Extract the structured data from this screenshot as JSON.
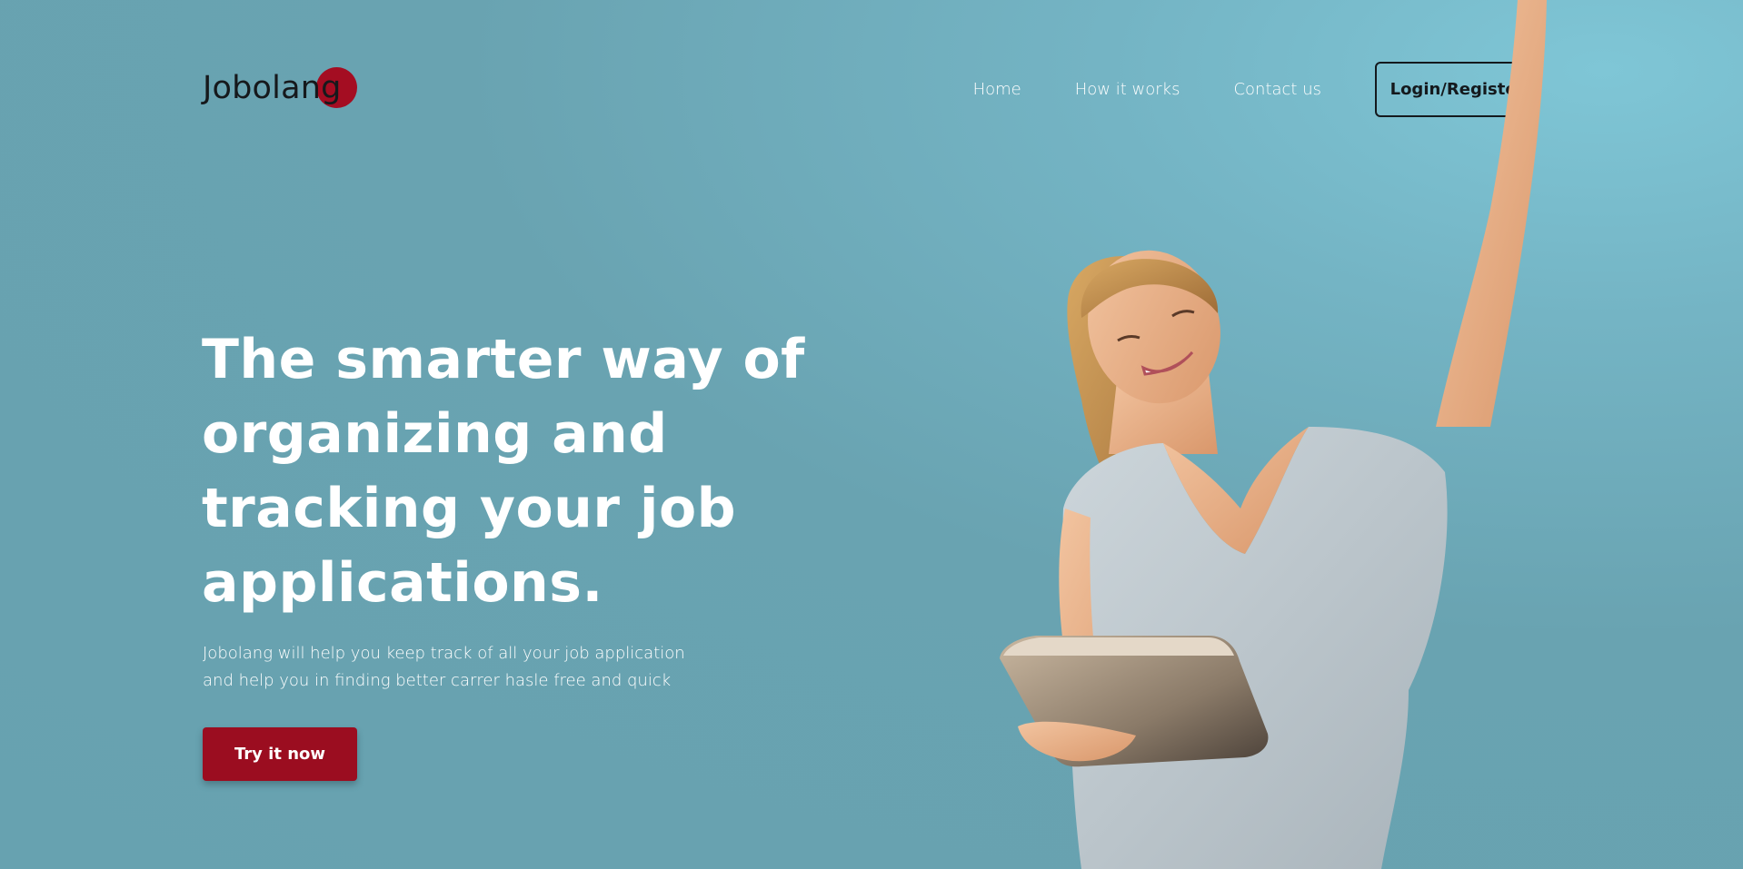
{
  "brand": {
    "name": "Jobolang",
    "accent_color": "#a40d22"
  },
  "nav": {
    "items": [
      {
        "label": "Home"
      },
      {
        "label": "How it works"
      },
      {
        "label": "Contact us"
      }
    ],
    "login_label": "Login/Register"
  },
  "hero": {
    "title": "The smarter way of organizing and tracking your job applications.",
    "subtitle_line1": "Jobolang will help you keep track of all your job application",
    "subtitle_line2": "and help you in finding better carrer hasle free and quick",
    "cta_label": "Try it now",
    "cta_color": "#9b0d20"
  },
  "colors": {
    "background": "#67a2b0",
    "text_dark": "#14191d"
  }
}
